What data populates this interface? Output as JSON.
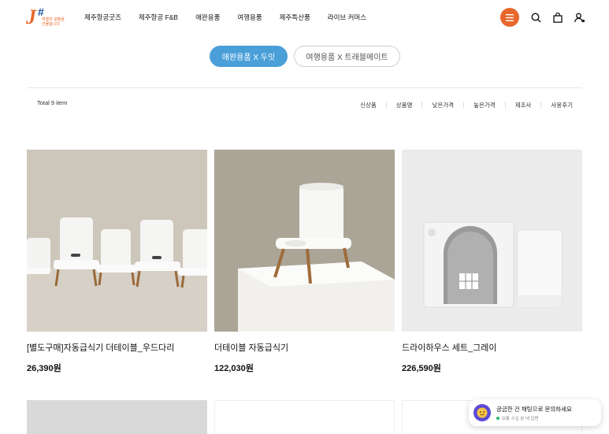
{
  "logo": {
    "mark": "J",
    "hash": "#",
    "tagline": "여행의 설렘을 선물합니다"
  },
  "nav": {
    "items": [
      "제주항공굿즈",
      "제주항공 F&B",
      "애완용품",
      "여행용품",
      "제주특산품",
      "라이브 커머스"
    ]
  },
  "header_icons": [
    "menu-icon",
    "search-icon",
    "shopping-bag-icon",
    "user-icon"
  ],
  "filters": {
    "active": "애완용품 X 두잇",
    "inactive": "여행용품 X 트래블메이트"
  },
  "listing": {
    "total": "Total 9 item",
    "sort_options": [
      "신상품",
      "상품명",
      "낮은가격",
      "높은가격",
      "제조사",
      "사용후기"
    ]
  },
  "products": [
    {
      "name": "[별도구매]자동급식기 더테이블_우드다리",
      "price": "26,390원"
    },
    {
      "name": "더테이블 자동급식기",
      "price": "122,030원"
    },
    {
      "name": "드라이하우스 세트_그레이",
      "price": "226,590원"
    }
  ],
  "chat": {
    "title": "궁금한 건 채팅으로 문의하세요",
    "status": "보통 수십 분 내 답변"
  },
  "colors": {
    "accent": "#e8672c",
    "pill_active": "#4a9fd8",
    "chat_avatar": "#5b4bd6"
  }
}
